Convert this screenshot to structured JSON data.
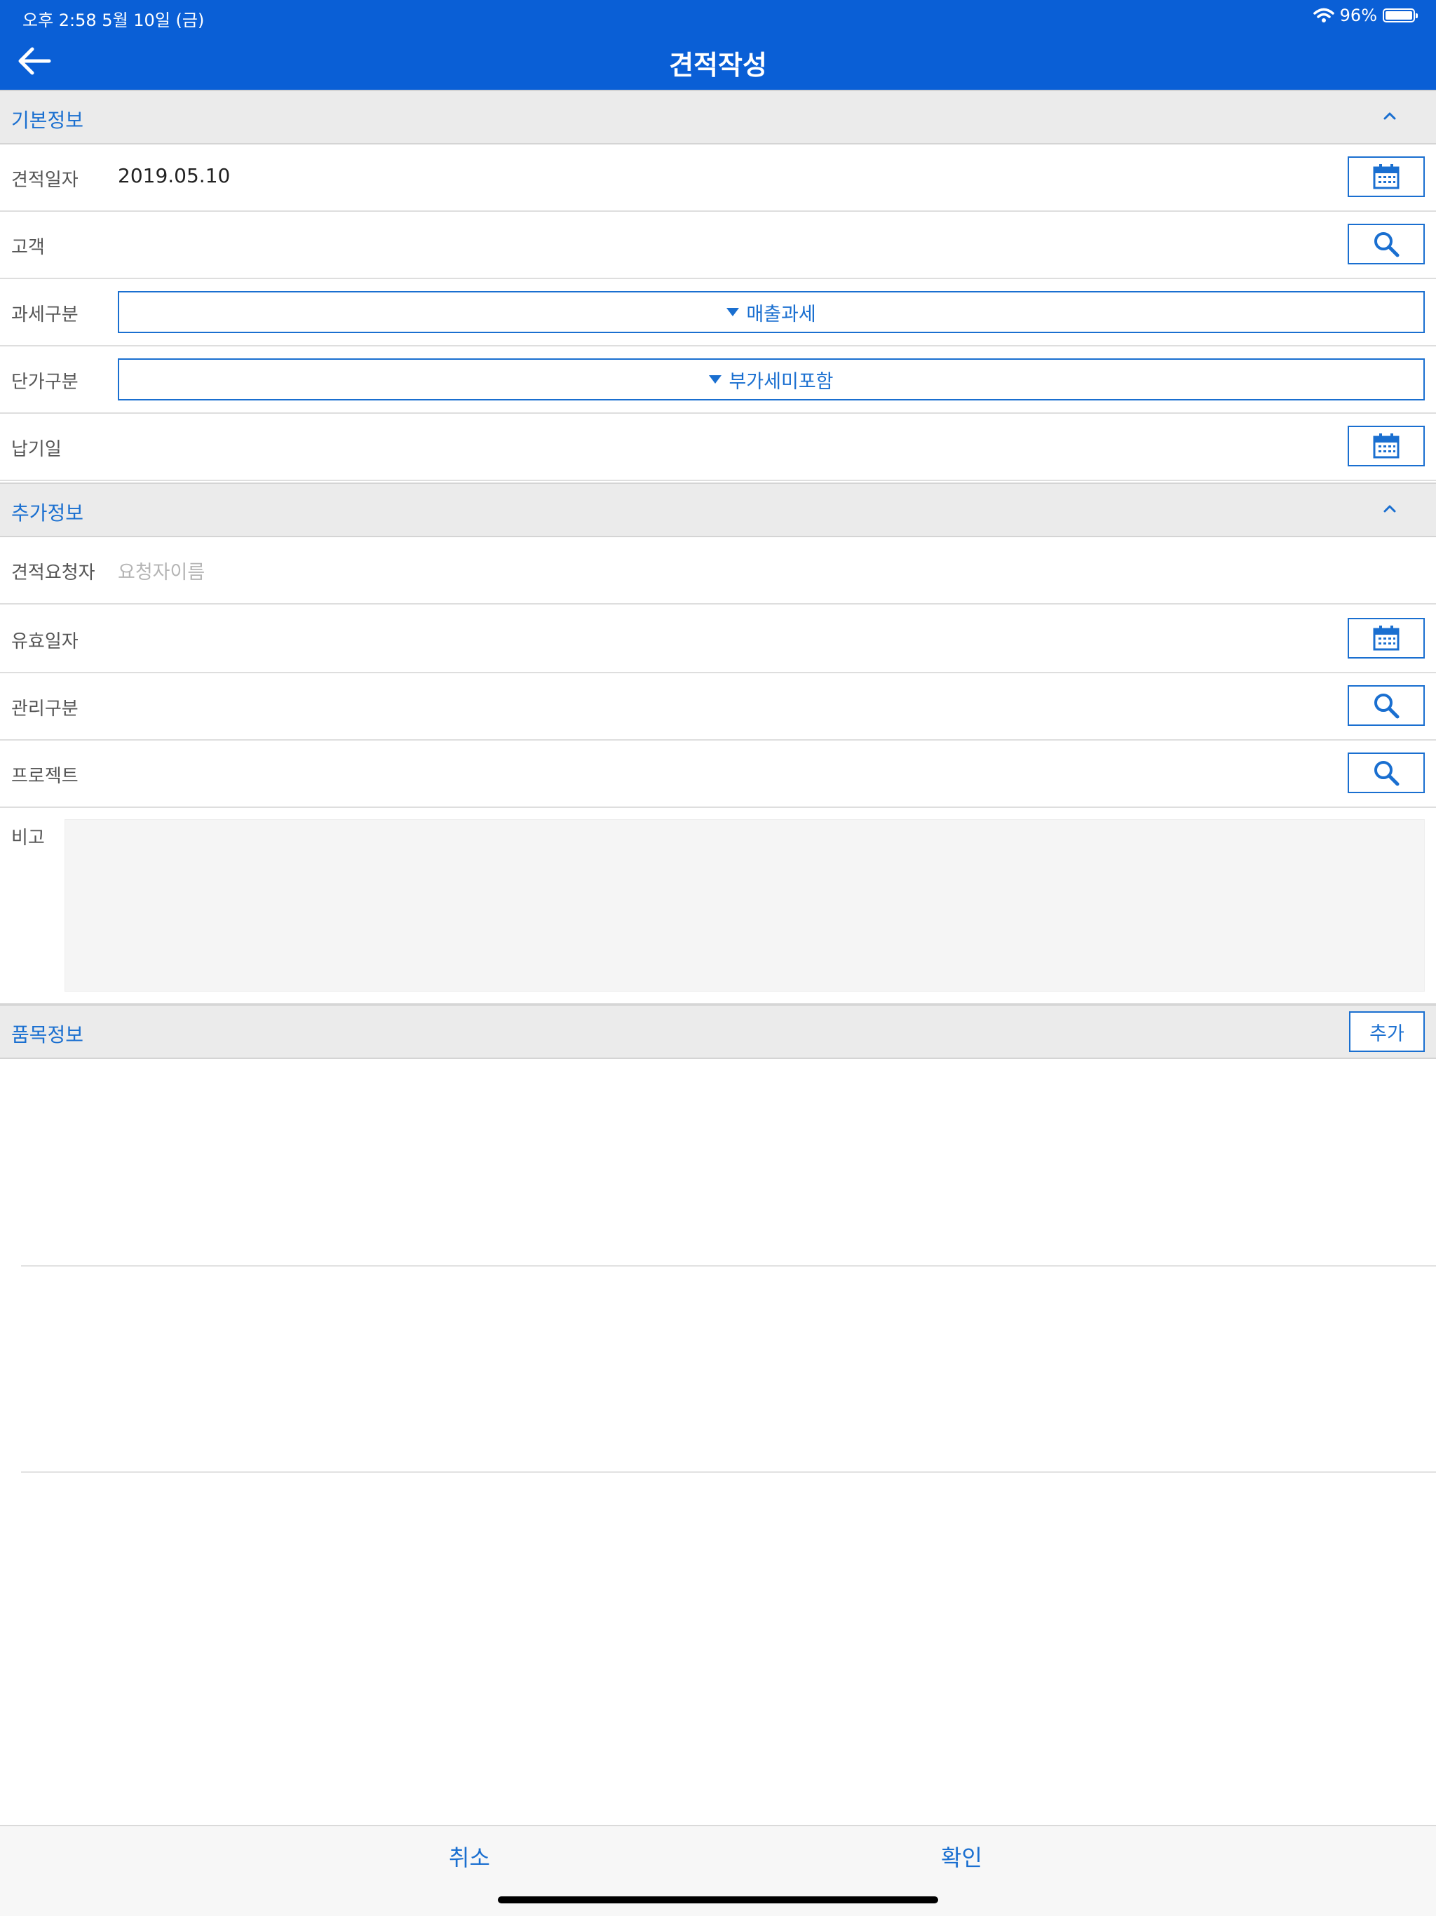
{
  "status_bar": {
    "time_date": "오후 2:58   5월 10일 (금)",
    "battery": "96%",
    "battery_level": 0.96,
    "wifi_icon": "wifi-icon"
  },
  "nav": {
    "title": "견적작성",
    "back_icon": "back-arrow-icon"
  },
  "basic_info": {
    "header": "기본정보",
    "collapse_icon": "chevron-up-icon",
    "quote_date": {
      "label": "견적일자",
      "value": "2019.05.10",
      "icon": "calendar-icon"
    },
    "customer": {
      "label": "고객",
      "icon": "search-icon"
    },
    "tax_type": {
      "label": "과세구분",
      "selected": "매출과세"
    },
    "price_type": {
      "label": "단가구분",
      "selected": "부가세미포함"
    },
    "delivery_date": {
      "label": "납기일",
      "icon": "calendar-icon"
    }
  },
  "extra_info": {
    "header": "추가정보",
    "collapse_icon": "chevron-up-icon",
    "requester": {
      "label": "견적요청자",
      "placeholder": "요청자이름"
    },
    "valid_date": {
      "label": "유효일자",
      "icon": "calendar-icon"
    },
    "management": {
      "label": "관리구분",
      "icon": "search-icon"
    },
    "project": {
      "label": "프로젝트",
      "icon": "search-icon"
    },
    "memo": {
      "label": "비고"
    }
  },
  "item_info": {
    "header": "품목정보",
    "add_label": "추가"
  },
  "bottom": {
    "cancel": "취소",
    "confirm": "확인"
  },
  "colors": {
    "primary": "#0a5fd6",
    "accent": "#1a6fd0",
    "section_bg": "#ebebeb"
  }
}
